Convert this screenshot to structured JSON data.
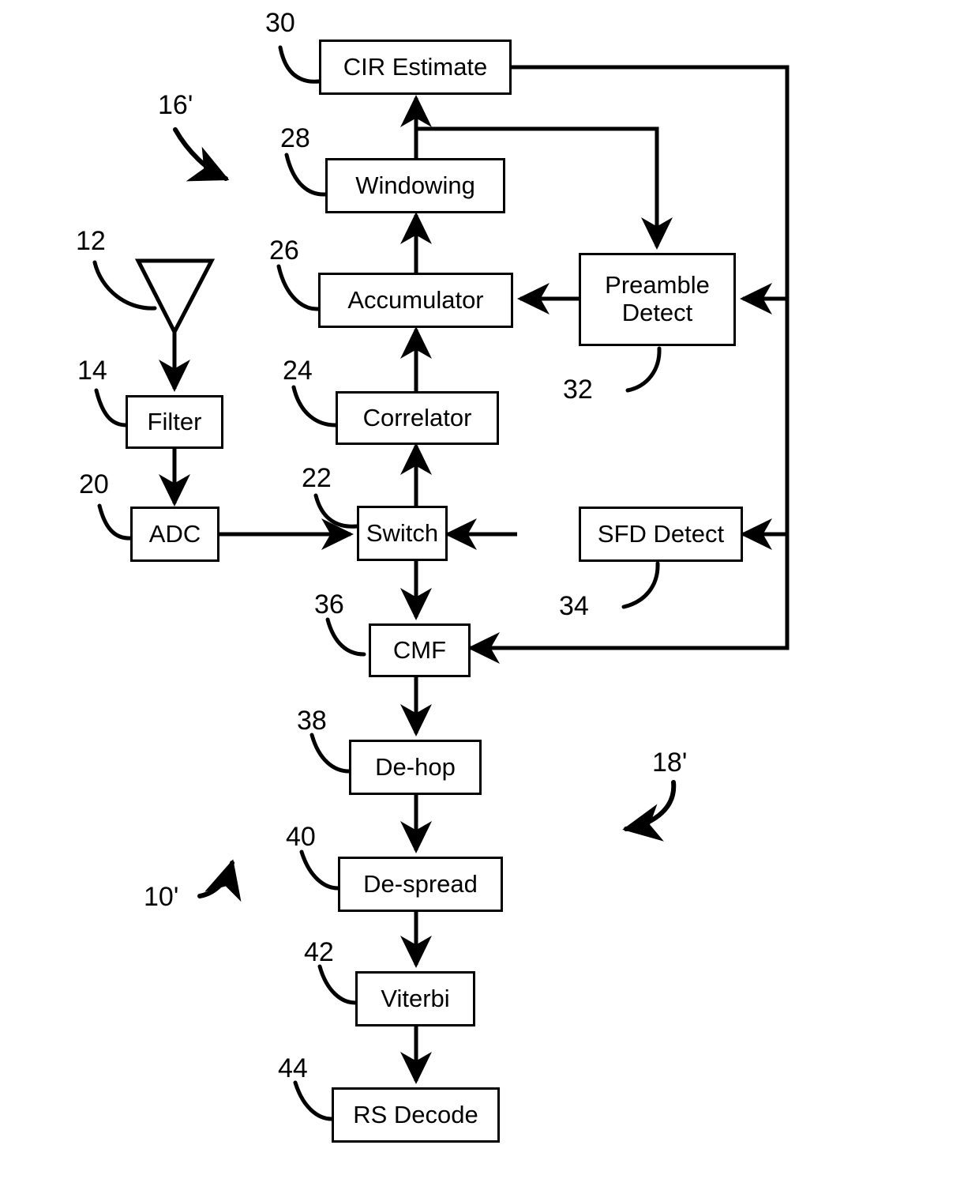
{
  "figure": {
    "kind": "patent-block-diagram",
    "title": "",
    "line_color": "#000000",
    "background_color": "#ffffff",
    "text_color": "#000000"
  },
  "blocks": [
    {
      "id": "cir_estimate",
      "label": "CIR Estimate",
      "ref": "30"
    },
    {
      "id": "windowing",
      "label": "Windowing",
      "ref": "28"
    },
    {
      "id": "accumulator",
      "label": "Accumulator",
      "ref": "26"
    },
    {
      "id": "correlator",
      "label": "Correlator",
      "ref": "24"
    },
    {
      "id": "switch",
      "label": "Switch",
      "ref": "22"
    },
    {
      "id": "cmf",
      "label": "CMF",
      "ref": "36"
    },
    {
      "id": "de_hop",
      "label": "De-hop",
      "ref": "38"
    },
    {
      "id": "de_spread",
      "label": "De-spread",
      "ref": "40"
    },
    {
      "id": "viterbi",
      "label": "Viterbi",
      "ref": "42"
    },
    {
      "id": "rs_decode",
      "label": "RS Decode",
      "ref": "44"
    },
    {
      "id": "preamble",
      "label": "Preamble\nDetect",
      "ref": "32"
    },
    {
      "id": "sfd_detect",
      "label": "SFD Detect",
      "ref": "34"
    },
    {
      "id": "filter",
      "label": "Filter",
      "ref": "14"
    },
    {
      "id": "adc",
      "label": "ADC",
      "ref": "20"
    },
    {
      "id": "antenna",
      "label": "",
      "ref": "12"
    }
  ],
  "block_labels": {
    "cir_estimate": "CIR Estimate",
    "windowing": "Windowing",
    "accumulator": "Accumulator",
    "correlator": "Correlator",
    "switch": "Switch",
    "cmf": "CMF",
    "de_hop": "De-hop",
    "de_spread": "De-spread",
    "viterbi": "Viterbi",
    "rs_decode": "RS Decode",
    "preamble_line1": "Preamble",
    "preamble_line2": "Detect",
    "sfd_detect": "SFD Detect",
    "filter": "Filter",
    "adc": "ADC"
  },
  "reference_numerals": {
    "cir_estimate": "30",
    "windowing": "28",
    "accumulator": "26",
    "correlator": "24",
    "switch": "22",
    "cmf": "36",
    "de_hop": "38",
    "de_spread": "40",
    "viterbi": "42",
    "rs_decode": "44",
    "preamble": "32",
    "sfd_detect": "34",
    "antenna": "12",
    "filter": "14",
    "adc": "20",
    "receiver_front_end": "16'",
    "system": "10'",
    "baseband_section": "18'"
  },
  "connections": [
    {
      "from": "antenna",
      "to": "filter",
      "type": "arrow-down"
    },
    {
      "from": "filter",
      "to": "adc",
      "type": "arrow-down"
    },
    {
      "from": "adc",
      "to": "switch",
      "type": "arrow-right"
    },
    {
      "from": "switch",
      "to": "correlator",
      "type": "arrow-up"
    },
    {
      "from": "correlator",
      "to": "accumulator",
      "type": "arrow-up"
    },
    {
      "from": "accumulator",
      "to": "windowing",
      "type": "arrow-up"
    },
    {
      "from": "windowing",
      "to": "cir_estimate",
      "type": "arrow-up"
    },
    {
      "from": "windowing",
      "to": "preamble",
      "type": "arrow-down-branch"
    },
    {
      "from": "preamble",
      "to": "accumulator",
      "type": "arrow-left"
    },
    {
      "from": "cir_estimate",
      "to": "preamble",
      "type": "arrow-left-feedback"
    },
    {
      "from": "cir_estimate",
      "to": "sfd_detect",
      "type": "arrow-left-feedback"
    },
    {
      "from": "cir_estimate",
      "to": "cmf",
      "type": "arrow-left-feedback"
    },
    {
      "from": "sfd_detect",
      "to": "switch",
      "type": "arrow-left"
    },
    {
      "from": "switch",
      "to": "cmf",
      "type": "arrow-down"
    },
    {
      "from": "cmf",
      "to": "de_hop",
      "type": "arrow-down"
    },
    {
      "from": "de_hop",
      "to": "de_spread",
      "type": "arrow-down"
    },
    {
      "from": "de_spread",
      "to": "viterbi",
      "type": "arrow-down"
    },
    {
      "from": "viterbi",
      "to": "rs_decode",
      "type": "arrow-down"
    }
  ]
}
